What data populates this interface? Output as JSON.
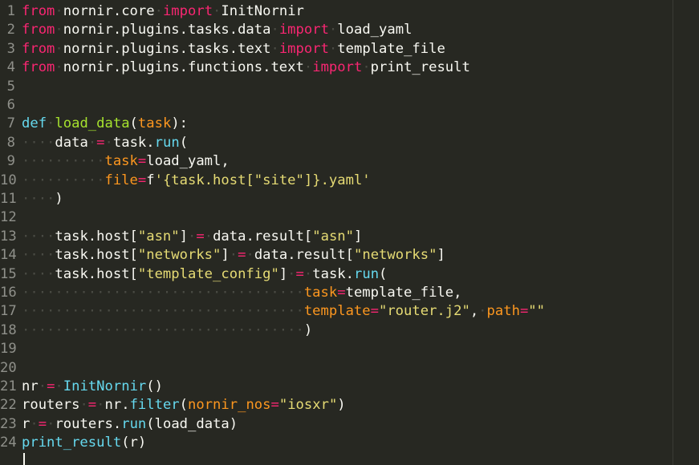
{
  "editor": {
    "theme": "monokai",
    "colors": {
      "background": "#272822",
      "default": "#f8f8f2",
      "keyword": "#f92672",
      "function": "#66d9ef",
      "param": "#fd971f",
      "string": "#e6db74",
      "defname": "#a6e22e",
      "whitespace": "#4a4b44",
      "gutter": "#8f908a"
    },
    "lines": [
      {
        "num": "1",
        "tokens": [
          [
            "kw",
            "from"
          ],
          [
            "ws",
            "·"
          ],
          [
            "",
            "nornir.core"
          ],
          [
            "ws",
            "·"
          ],
          [
            "kw",
            "import"
          ],
          [
            "ws",
            "·"
          ],
          [
            "",
            "InitNornir"
          ]
        ]
      },
      {
        "num": "2",
        "tokens": [
          [
            "kw",
            "from"
          ],
          [
            "ws",
            "·"
          ],
          [
            "",
            "nornir.plugins.tasks.data"
          ],
          [
            "ws",
            "·"
          ],
          [
            "kw",
            "import"
          ],
          [
            "ws",
            "·"
          ],
          [
            "",
            "load_yaml"
          ]
        ]
      },
      {
        "num": "3",
        "tokens": [
          [
            "kw",
            "from"
          ],
          [
            "ws",
            "·"
          ],
          [
            "",
            "nornir.plugins.tasks.text"
          ],
          [
            "ws",
            "·"
          ],
          [
            "kw",
            "import"
          ],
          [
            "ws",
            "·"
          ],
          [
            "",
            "template_file"
          ]
        ]
      },
      {
        "num": "4",
        "tokens": [
          [
            "kw",
            "from"
          ],
          [
            "ws",
            "·"
          ],
          [
            "",
            "nornir.plugins.functions.text"
          ],
          [
            "ws",
            "·"
          ],
          [
            "kw",
            "import"
          ],
          [
            "ws",
            "·"
          ],
          [
            "",
            "print_result"
          ]
        ]
      },
      {
        "num": "5",
        "tokens": []
      },
      {
        "num": "6",
        "tokens": []
      },
      {
        "num": "7",
        "tokens": [
          [
            "fn",
            "def"
          ],
          [
            "ws",
            "·"
          ],
          [
            "df",
            "load_data"
          ],
          [
            "",
            "("
          ],
          [
            "pa",
            "task"
          ],
          [
            "",
            "):"
          ]
        ]
      },
      {
        "num": "8",
        "tokens": [
          [
            "ws",
            "····"
          ],
          [
            "",
            "data"
          ],
          [
            "ws",
            "·"
          ],
          [
            "kw",
            "="
          ],
          [
            "ws",
            "·"
          ],
          [
            "",
            "task."
          ],
          [
            "fn",
            "run"
          ],
          [
            "",
            "("
          ]
        ]
      },
      {
        "num": "9",
        "tokens": [
          [
            "ws",
            "··········"
          ],
          [
            "pa",
            "task"
          ],
          [
            "kw",
            "="
          ],
          [
            "",
            "load_yaml,"
          ]
        ]
      },
      {
        "num": "10",
        "tokens": [
          [
            "ws",
            "··········"
          ],
          [
            "pa",
            "file"
          ],
          [
            "kw",
            "="
          ],
          [
            "",
            "f"
          ],
          [
            "st",
            "'{task.host[\"site\"]}.yaml'"
          ]
        ]
      },
      {
        "num": "11",
        "tokens": [
          [
            "ws",
            "····"
          ],
          [
            "",
            ")"
          ]
        ]
      },
      {
        "num": "12",
        "tokens": []
      },
      {
        "num": "13",
        "tokens": [
          [
            "ws",
            "····"
          ],
          [
            "",
            "task.host["
          ],
          [
            "st",
            "\"asn\""
          ],
          [
            "",
            "]"
          ],
          [
            "ws",
            "·"
          ],
          [
            "kw",
            "="
          ],
          [
            "ws",
            "·"
          ],
          [
            "",
            "data.result["
          ],
          [
            "st",
            "\"asn\""
          ],
          [
            "",
            "]"
          ]
        ]
      },
      {
        "num": "14",
        "tokens": [
          [
            "ws",
            "····"
          ],
          [
            "",
            "task.host["
          ],
          [
            "st",
            "\"networks\""
          ],
          [
            "",
            "]"
          ],
          [
            "ws",
            "·"
          ],
          [
            "kw",
            "="
          ],
          [
            "ws",
            "·"
          ],
          [
            "",
            "data.result["
          ],
          [
            "st",
            "\"networks\""
          ],
          [
            "",
            "]"
          ]
        ]
      },
      {
        "num": "15",
        "tokens": [
          [
            "ws",
            "····"
          ],
          [
            "",
            "task.host["
          ],
          [
            "st",
            "\"template_config\""
          ],
          [
            "",
            "]"
          ],
          [
            "ws",
            "·"
          ],
          [
            "kw",
            "="
          ],
          [
            "ws",
            "·"
          ],
          [
            "",
            "task."
          ],
          [
            "fn",
            "run"
          ],
          [
            "",
            "("
          ]
        ]
      },
      {
        "num": "16",
        "tokens": [
          [
            "ws",
            "··································"
          ],
          [
            "pa",
            "task"
          ],
          [
            "kw",
            "="
          ],
          [
            "",
            "template_file,"
          ]
        ]
      },
      {
        "num": "17",
        "tokens": [
          [
            "ws",
            "··································"
          ],
          [
            "pa",
            "template"
          ],
          [
            "kw",
            "="
          ],
          [
            "st",
            "\"router.j2\""
          ],
          [
            "",
            ","
          ],
          [
            "ws",
            "·"
          ],
          [
            "pa",
            "path"
          ],
          [
            "kw",
            "="
          ],
          [
            "st",
            "\"\""
          ]
        ]
      },
      {
        "num": "18",
        "tokens": [
          [
            "ws",
            "··································"
          ],
          [
            "",
            ")"
          ]
        ]
      },
      {
        "num": "19",
        "tokens": []
      },
      {
        "num": "20",
        "tokens": []
      },
      {
        "num": "21",
        "tokens": [
          [
            "",
            "nr"
          ],
          [
            "ws",
            "·"
          ],
          [
            "kw",
            "="
          ],
          [
            "ws",
            "·"
          ],
          [
            "fn",
            "InitNornir"
          ],
          [
            "",
            "()"
          ]
        ]
      },
      {
        "num": "22",
        "tokens": [
          [
            "",
            "routers"
          ],
          [
            "ws",
            "·"
          ],
          [
            "kw",
            "="
          ],
          [
            "ws",
            "·"
          ],
          [
            "",
            "nr."
          ],
          [
            "fn",
            "filter"
          ],
          [
            "",
            "("
          ],
          [
            "pa",
            "nornir_nos"
          ],
          [
            "kw",
            "="
          ],
          [
            "st",
            "\"iosxr\""
          ],
          [
            "",
            ")"
          ]
        ]
      },
      {
        "num": "23",
        "tokens": [
          [
            "",
            "r"
          ],
          [
            "ws",
            "·"
          ],
          [
            "kw",
            "="
          ],
          [
            "ws",
            "·"
          ],
          [
            "",
            "routers."
          ],
          [
            "fn",
            "run"
          ],
          [
            "",
            "(load_data)"
          ]
        ]
      },
      {
        "num": "24",
        "tokens": [
          [
            "fn",
            "print_result"
          ],
          [
            "",
            "(r)"
          ]
        ]
      }
    ]
  }
}
